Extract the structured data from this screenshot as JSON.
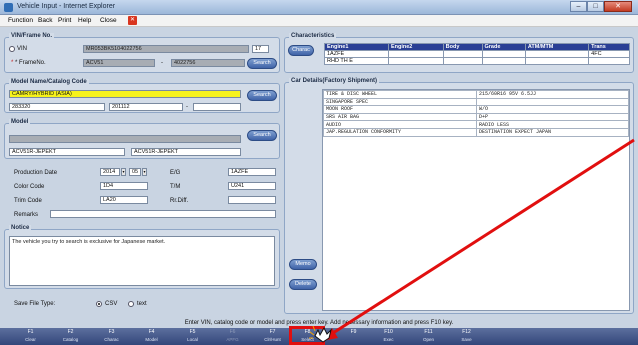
{
  "window": {
    "title": "Vehicle Input - Internet Explorer",
    "controls": [
      "–",
      "□",
      "✕"
    ]
  },
  "menu": {
    "items": [
      "Function",
      "Back",
      "Print",
      "Help",
      "Close"
    ],
    "close_icon": "close-x-icon"
  },
  "vin_group": {
    "title": "VIN/Frame No.",
    "vin_label": "VIN",
    "vin_value": "MR053BK5104022756",
    "vin_len": "17",
    "frame_label": "* FrameNo.",
    "frame_value1": "ACV51",
    "frame_sep": "-",
    "frame_value2": "4022756",
    "search": "Search"
  },
  "model_name_group": {
    "title": "Model Name/Catalog Code",
    "model_name": "CAMRY/HYBRID (ASIA)",
    "code1": "283320",
    "code2": "201112",
    "sep": "-",
    "code3": "",
    "search": "Search"
  },
  "model_group": {
    "title": "Model",
    "model_value": "",
    "field1": "ACV51R-JEPEKT",
    "field2": "ACV51R-JEPEKT",
    "search": "Search"
  },
  "production": {
    "date_label": "Production Date",
    "year": "2014",
    "month": "05",
    "eg_label": "E/G",
    "eg_value": "1AZFE",
    "color_label": "Color Code",
    "color_value": "1D4",
    "tm_label": "T/M",
    "tm_value": "U241",
    "trim_label": "Trim Code",
    "trim_value": "LA20",
    "rrdiff_label": "Rr.Diff.",
    "rrdiff_value": "",
    "remarks_label": "Remarks",
    "remarks_value": ""
  },
  "notice": {
    "title": "Notice",
    "text": "The vehicle you try to search is exclusive for Japanese market."
  },
  "save_file": {
    "label": "Save File Type:",
    "opt1": "CSV",
    "opt2": "text",
    "selected": "CSV"
  },
  "characteristics": {
    "title": "Characteristics",
    "button": "Charac",
    "headers": [
      "Engine1",
      "Engine2",
      "Body",
      "Grade",
      "ATM/MTM",
      "Trans"
    ],
    "row1": [
      "1AZFE",
      "",
      "",
      "",
      "",
      "4FC"
    ],
    "row2": [
      "RHD TH E",
      "",
      "",
      "",
      "",
      ""
    ]
  },
  "car_details": {
    "title": "Car Details(Factory Shipment)",
    "rows": [
      [
        "TIRE & DISC WHEEL",
        "215/60R16 95V 6.5JJ"
      ],
      [
        "SINGAPORE SPEC",
        ""
      ],
      [
        "MOON ROOF",
        "W/O"
      ],
      [
        "SRS AIR BAG",
        "D+P"
      ],
      [
        "AUDIO",
        "RADIO LESS"
      ],
      [
        "JAP.REGULATION CONFORMITY",
        "DESTINATION EXPECT JAPAN"
      ]
    ],
    "memo": "Memo",
    "delete": "Delete"
  },
  "status": {
    "text": "Enter VIN, catalog code or model and press enter key. Add necessary information and press F10 key."
  },
  "fkeys": [
    {
      "n": "F1",
      "d": "Clear",
      "dim": false
    },
    {
      "n": "F2",
      "d": "Catalog",
      "dim": false
    },
    {
      "n": "F3",
      "d": "Charac",
      "dim": false
    },
    {
      "n": "F4",
      "d": "Model",
      "dim": false
    },
    {
      "n": "F5",
      "d": "Local",
      "dim": false
    },
    {
      "n": "F6",
      "d": "APFG",
      "dim": true
    },
    {
      "n": "F7",
      "d": "Clr/Hunt",
      "dim": false
    },
    {
      "n": "F8",
      "d": "Select",
      "dim": false
    },
    {
      "n": "F9",
      "d": "",
      "dim": false
    },
    {
      "n": "F10",
      "d": "Exec",
      "dim": false
    },
    {
      "n": "F11",
      "d": "Open",
      "dim": false
    },
    {
      "n": "F12",
      "d": "Save",
      "dim": false
    }
  ],
  "colors": {
    "accent": "#3f63a8",
    "annotation": "#e10f0f",
    "highlight_field": "#f6f21b"
  }
}
